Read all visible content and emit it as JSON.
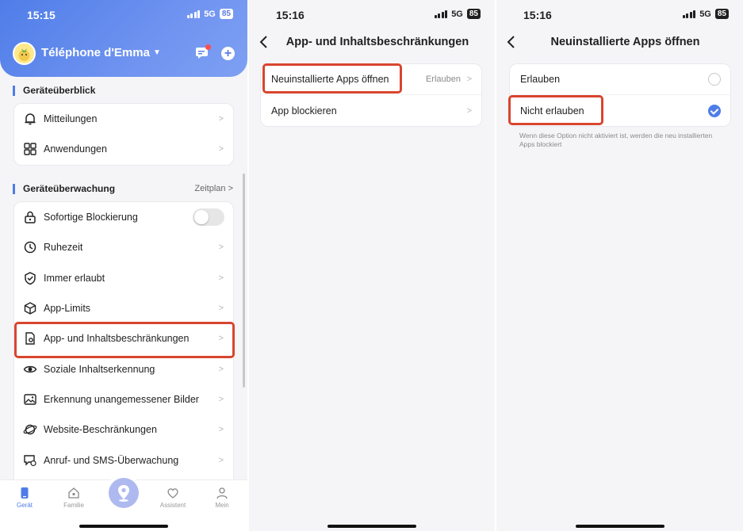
{
  "screens": [
    {
      "status": {
        "time": "15:15",
        "network": "5G",
        "battery": "85"
      },
      "header": {
        "device_name": "Téléphone d'Emma"
      },
      "overview": {
        "title": "Geräteüberblick",
        "items": [
          {
            "label": "Mitteilungen",
            "icon": "bell-icon"
          },
          {
            "label": "Anwendungen",
            "icon": "grid-icon"
          }
        ]
      },
      "monitoring": {
        "title": "Geräteüberwachung",
        "action": "Zeitplan",
        "items": [
          {
            "label": "Sofortige Blockierung",
            "icon": "lock-icon",
            "toggle": false
          },
          {
            "label": "Ruhezeit",
            "icon": "clock-icon"
          },
          {
            "label": "Immer erlaubt",
            "icon": "check-shield-icon"
          },
          {
            "label": "App-Limits",
            "icon": "cube-icon"
          },
          {
            "label": "App- und Inhaltsbeschränkungen",
            "icon": "settings-page-icon",
            "highlighted": true
          },
          {
            "label": "Soziale Inhaltserkennung",
            "icon": "eye-icon"
          },
          {
            "label": "Erkennung unangemessener Bilder",
            "icon": "image-icon"
          },
          {
            "label": "Website-Beschränkungen",
            "icon": "planet-icon"
          },
          {
            "label": "Anruf- und SMS-Überwachung",
            "icon": "chat-icon"
          }
        ]
      },
      "tabs": [
        {
          "label": "Gerät",
          "icon": "phone-icon",
          "active": true
        },
        {
          "label": "Familie",
          "icon": "house-icon",
          "active": false
        },
        {
          "label": "Assistent",
          "icon": "heart-icon",
          "active": false
        },
        {
          "label": "Mein",
          "icon": "person-icon",
          "active": false
        }
      ]
    },
    {
      "status": {
        "time": "15:16",
        "network": "5G",
        "battery": "85"
      },
      "title": "App- und Inhaltsbeschränkungen",
      "items": [
        {
          "label": "Neuinstallierte Apps öffnen",
          "value": "Erlauben",
          "highlighted": true
        },
        {
          "label": "App blockieren",
          "value": ""
        }
      ]
    },
    {
      "status": {
        "time": "15:16",
        "network": "5G",
        "battery": "85"
      },
      "title": "Neuinstallierte Apps öffnen",
      "options": [
        {
          "label": "Erlauben",
          "selected": false
        },
        {
          "label": "Nicht erlauben",
          "selected": true,
          "highlighted": true
        }
      ],
      "note": "Wenn diese Option nicht aktiviert ist, werden die neu installierten Apps blockiert"
    }
  ],
  "colors": {
    "accent": "#4f7de8",
    "highlight": "#d9452e",
    "background": "#f5f5f7"
  }
}
